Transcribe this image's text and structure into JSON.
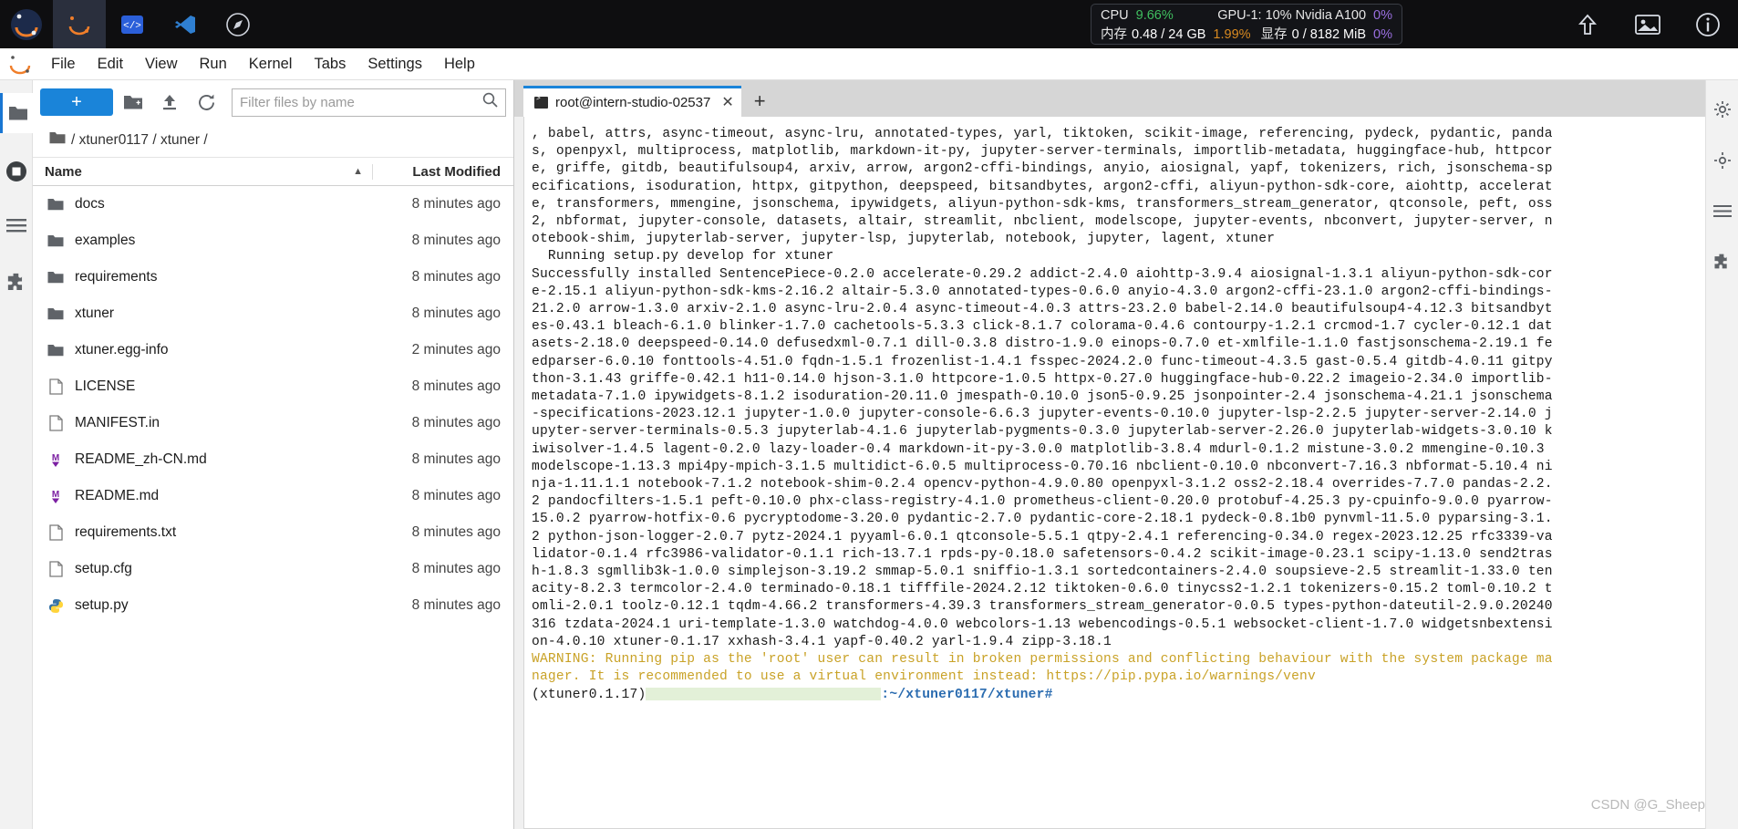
{
  "topbar": {
    "icons": [
      {
        "name": "jupyter-logo-icon",
        "label": "jupyter"
      },
      {
        "name": "launcher-icon",
        "label": "launcher"
      },
      {
        "name": "code-icon",
        "label": "code"
      },
      {
        "name": "vscode-icon",
        "label": "vscode"
      },
      {
        "name": "compass-icon",
        "label": "compass"
      }
    ],
    "right_icons": [
      {
        "name": "upload-arrow-icon",
        "label": "upload"
      },
      {
        "name": "image-icon",
        "label": "image"
      },
      {
        "name": "info-icon",
        "label": "info"
      }
    ],
    "stats": {
      "cpu_label": "CPU",
      "cpu_value": "9.66%",
      "mem_label": "内存",
      "mem_value": "0.48 / 24 GB",
      "mem_pct": "1.99%",
      "gpu_label": "GPU-1: 10% Nvidia A100",
      "gpu_pct": "0%",
      "vram_label": "显存",
      "vram_value": "0 / 8182 MiB",
      "vram_pct": "0%",
      "colors": {
        "cpu": "#3fbf5f",
        "mem_pct": "#d98a20",
        "vram_pct": "#9a6fe0",
        "gpu_pct": "#9a6fe0",
        "panel_bg": "#131418"
      }
    }
  },
  "menubar": {
    "items": [
      "File",
      "Edit",
      "View",
      "Run",
      "Kernel",
      "Tabs",
      "Settings",
      "Help"
    ]
  },
  "rail": {
    "items": [
      {
        "name": "sidebar-item-file-browser",
        "icon": "folder-icon"
      },
      {
        "name": "sidebar-item-running",
        "icon": "stop-circle-icon"
      },
      {
        "name": "sidebar-item-commands",
        "icon": "list-icon"
      },
      {
        "name": "sidebar-item-extensions",
        "icon": "puzzle-icon"
      }
    ],
    "right_items": [
      {
        "name": "sidebar-item-property-inspector",
        "icon": "gear-icon"
      },
      {
        "name": "sidebar-item-settings",
        "icon": "gear-icon"
      },
      {
        "name": "sidebar-item-toc",
        "icon": "list-icon"
      },
      {
        "name": "sidebar-item-extension-manager",
        "icon": "puzzle-icon"
      }
    ]
  },
  "filebrowser": {
    "new_button_label": "+",
    "toolbar_icons": [
      {
        "name": "new-folder-icon"
      },
      {
        "name": "upload-icon"
      },
      {
        "name": "refresh-icon"
      }
    ],
    "filter_placeholder": "Filter files by name",
    "filter_value": "",
    "search_icon": "search-icon",
    "breadcrumb": "/ xtuner0117 / xtuner /",
    "columns": {
      "name": "Name",
      "modified": "Last Modified"
    },
    "sort_direction": "ascending",
    "rows": [
      {
        "icon": "folder-icon",
        "name": "docs",
        "modified": "8 minutes ago"
      },
      {
        "icon": "folder-icon",
        "name": "examples",
        "modified": "8 minutes ago"
      },
      {
        "icon": "folder-icon",
        "name": "requirements",
        "modified": "8 minutes ago"
      },
      {
        "icon": "folder-icon",
        "name": "xtuner",
        "modified": "8 minutes ago"
      },
      {
        "icon": "folder-icon",
        "name": "xtuner.egg-info",
        "modified": "2 minutes ago"
      },
      {
        "icon": "file-icon",
        "name": "LICENSE",
        "modified": "8 minutes ago"
      },
      {
        "icon": "file-icon",
        "name": "MANIFEST.in",
        "modified": "8 minutes ago"
      },
      {
        "icon": "markdown-icon",
        "name": "README_zh-CN.md",
        "modified": "8 minutes ago"
      },
      {
        "icon": "markdown-icon",
        "name": "README.md",
        "modified": "8 minutes ago"
      },
      {
        "icon": "file-icon",
        "name": "requirements.txt",
        "modified": "8 minutes ago"
      },
      {
        "icon": "file-icon",
        "name": "setup.cfg",
        "modified": "8 minutes ago"
      },
      {
        "icon": "python-icon",
        "name": "setup.py",
        "modified": "8 minutes ago"
      }
    ]
  },
  "main": {
    "tab_label": "root@intern-studio-02537",
    "tab_icon": "terminal-icon",
    "tab_close_label": "✕",
    "add_tab_label": "+",
    "terminal": {
      "lines_plain": ", babel, attrs, async-timeout, async-lru, annotated-types, yarl, tiktoken, scikit-image, referencing, pydeck, pydantic, panda\ns, openpyxl, multiprocess, matplotlib, markdown-it-py, jupyter-server-terminals, importlib-metadata, huggingface-hub, httpcor\ne, griffe, gitdb, beautifulsoup4, arxiv, arrow, argon2-cffi-bindings, anyio, aiosignal, yapf, tokenizers, rich, jsonschema-sp\necifications, isoduration, httpx, gitpython, deepspeed, bitsandbytes, argon2-cffi, aliyun-python-sdk-core, aiohttp, accelerat\ne, transformers, mmengine, jsonschema, ipywidgets, aliyun-python-sdk-kms, transformers_stream_generator, qtconsole, peft, oss\n2, nbformat, jupyter-console, datasets, altair, streamlit, nbclient, modelscope, jupyter-events, nbconvert, jupyter-server, n\notebook-shim, jupyterlab-server, jupyter-lsp, jupyterlab, notebook, jupyter, lagent, xtuner\n  Running setup.py develop for xtuner\nSuccessfully installed SentencePiece-0.2.0 accelerate-0.29.2 addict-2.4.0 aiohttp-3.9.4 aiosignal-1.3.1 aliyun-python-sdk-cor\ne-2.15.1 aliyun-python-sdk-kms-2.16.2 altair-5.3.0 annotated-types-0.6.0 anyio-4.3.0 argon2-cffi-23.1.0 argon2-cffi-bindings-\n21.2.0 arrow-1.3.0 arxiv-2.1.0 async-lru-2.0.4 async-timeout-4.0.3 attrs-23.2.0 babel-2.14.0 beautifulsoup4-4.12.3 bitsandbyt\nes-0.43.1 bleach-6.1.0 blinker-1.7.0 cachetools-5.3.3 click-8.1.7 colorama-0.4.6 contourpy-1.2.1 crcmod-1.7 cycler-0.12.1 dat\nasets-2.18.0 deepspeed-0.14.0 defusedxml-0.7.1 dill-0.3.8 distro-1.9.0 einops-0.7.0 et-xmlfile-1.1.0 fastjsonschema-2.19.1 fe\nedparser-6.0.10 fonttools-4.51.0 fqdn-1.5.1 frozenlist-1.4.1 fsspec-2024.2.0 func-timeout-4.3.5 gast-0.5.4 gitdb-4.0.11 gitpy\nthon-3.1.43 griffe-0.42.1 h11-0.14.0 hjson-3.1.0 httpcore-1.0.5 httpx-0.27.0 huggingface-hub-0.22.2 imageio-2.34.0 importlib-\nmetadata-7.1.0 ipywidgets-8.1.2 isoduration-20.11.0 jmespath-0.10.0 json5-0.9.25 jsonpointer-2.4 jsonschema-4.21.1 jsonschema\n-specifications-2023.12.1 jupyter-1.0.0 jupyter-console-6.6.3 jupyter-events-0.10.0 jupyter-lsp-2.2.5 jupyter-server-2.14.0 j\nupyter-server-terminals-0.5.3 jupyterlab-4.1.6 jupyterlab-pygments-0.3.0 jupyterlab-server-2.26.0 jupyterlab-widgets-3.0.10 k\niwisolver-1.4.5 lagent-0.2.0 lazy-loader-0.4 markdown-it-py-3.0.0 matplotlib-3.8.4 mdurl-0.1.2 mistune-3.0.2 mmengine-0.10.3\nmodelscope-1.13.3 mpi4py-mpich-3.1.5 multidict-6.0.5 multiprocess-0.70.16 nbclient-0.10.0 nbconvert-7.16.3 nbformat-5.10.4 ni\nnja-1.11.1.1 notebook-7.1.2 notebook-shim-0.2.4 opencv-python-4.9.0.80 openpyxl-3.1.2 oss2-2.18.4 overrides-7.7.0 pandas-2.2.\n2 pandocfilters-1.5.1 peft-0.10.0 phx-class-registry-4.1.0 prometheus-client-0.20.0 protobuf-4.25.3 py-cpuinfo-9.0.0 pyarrow-\n15.0.2 pyarrow-hotfix-0.6 pycryptodome-3.20.0 pydantic-2.7.0 pydantic-core-2.18.1 pydeck-0.8.1b0 pynvml-11.5.0 pyparsing-3.1.\n2 python-json-logger-2.0.7 pytz-2024.1 pyyaml-6.0.1 qtconsole-5.5.1 qtpy-2.4.1 referencing-0.34.0 regex-2023.12.25 rfc3339-va\nlidator-0.1.4 rfc3986-validator-0.1.1 rich-13.7.1 rpds-py-0.18.0 safetensors-0.4.2 scikit-image-0.23.1 scipy-1.13.0 send2tras\nh-1.8.3 sgmllib3k-1.0.0 simplejson-3.19.2 smmap-5.0.1 sniffio-1.3.1 sortedcontainers-2.4.0 soupsieve-2.5 streamlit-1.33.0 ten\nacity-8.2.3 termcolor-2.4.0 terminado-0.18.1 tifffile-2024.2.12 tiktoken-0.6.0 tinycss2-1.2.1 tokenizers-0.15.2 toml-0.10.2 t\nomli-2.0.1 toolz-0.12.1 tqdm-4.66.2 transformers-4.39.3 transformers_stream_generator-0.0.5 types-python-dateutil-2.9.0.20240\n316 tzdata-2024.1 uri-template-1.3.0 watchdog-4.0.0 webcolors-1.13 webencodings-0.5.1 websocket-client-1.7.0 widgetsnbextensi\non-4.0.10 xtuner-0.1.17 xxhash-3.4.1 yapf-0.40.2 yarl-1.9.4 zipp-3.18.1",
      "warning_line1": "WARNING: Running pip as the 'root' user can result in broken permissions and conflicting behaviour with the system package ma",
      "warning_line2": "nager. It is recommended to use a virtual environment instead: https://pip.pypa.io/warnings/venv",
      "prompt_prefix": "(xtuner0.1.17)",
      "prompt_path": ":~/xtuner0117/xtuner#",
      "warning_color": "#c9a227",
      "path_color": "#2b6cb0"
    },
    "scrollbar": {
      "up": "▲",
      "down": "▼"
    }
  },
  "watermark": "CSDN @G_Sheep"
}
